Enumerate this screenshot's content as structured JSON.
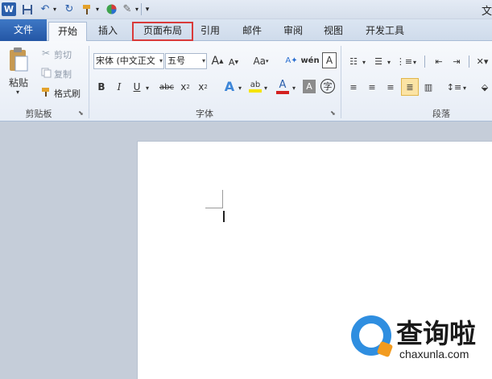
{
  "title_fragment": "文",
  "tabs": [
    {
      "label": "文件"
    },
    {
      "label": "开始"
    },
    {
      "label": "插入"
    },
    {
      "label": "页面布局"
    },
    {
      "label": "引用"
    },
    {
      "label": "邮件"
    },
    {
      "label": "审阅"
    },
    {
      "label": "视图"
    },
    {
      "label": "开发工具"
    }
  ],
  "clipboard": {
    "paste_label": "粘贴",
    "cut_label": "剪切",
    "copy_label": "复制",
    "format_painter_label": "格式刷",
    "group_label": "剪贴板"
  },
  "font": {
    "font_name": "宋体 (中文正文",
    "font_size": "五号",
    "group_label": "字体"
  },
  "paragraph": {
    "group_label": "段落"
  },
  "watermark": {
    "name": "查询啦",
    "url": "chaxunla.com"
  },
  "colors": {
    "file_tab": "#2456a5",
    "highlight_box": "#d93a3a",
    "font_color_bar": "#d32020",
    "highlight_color_bar": "#f5e400",
    "watermark_blue": "#2f8ee0",
    "watermark_orange": "#f29b1f"
  }
}
